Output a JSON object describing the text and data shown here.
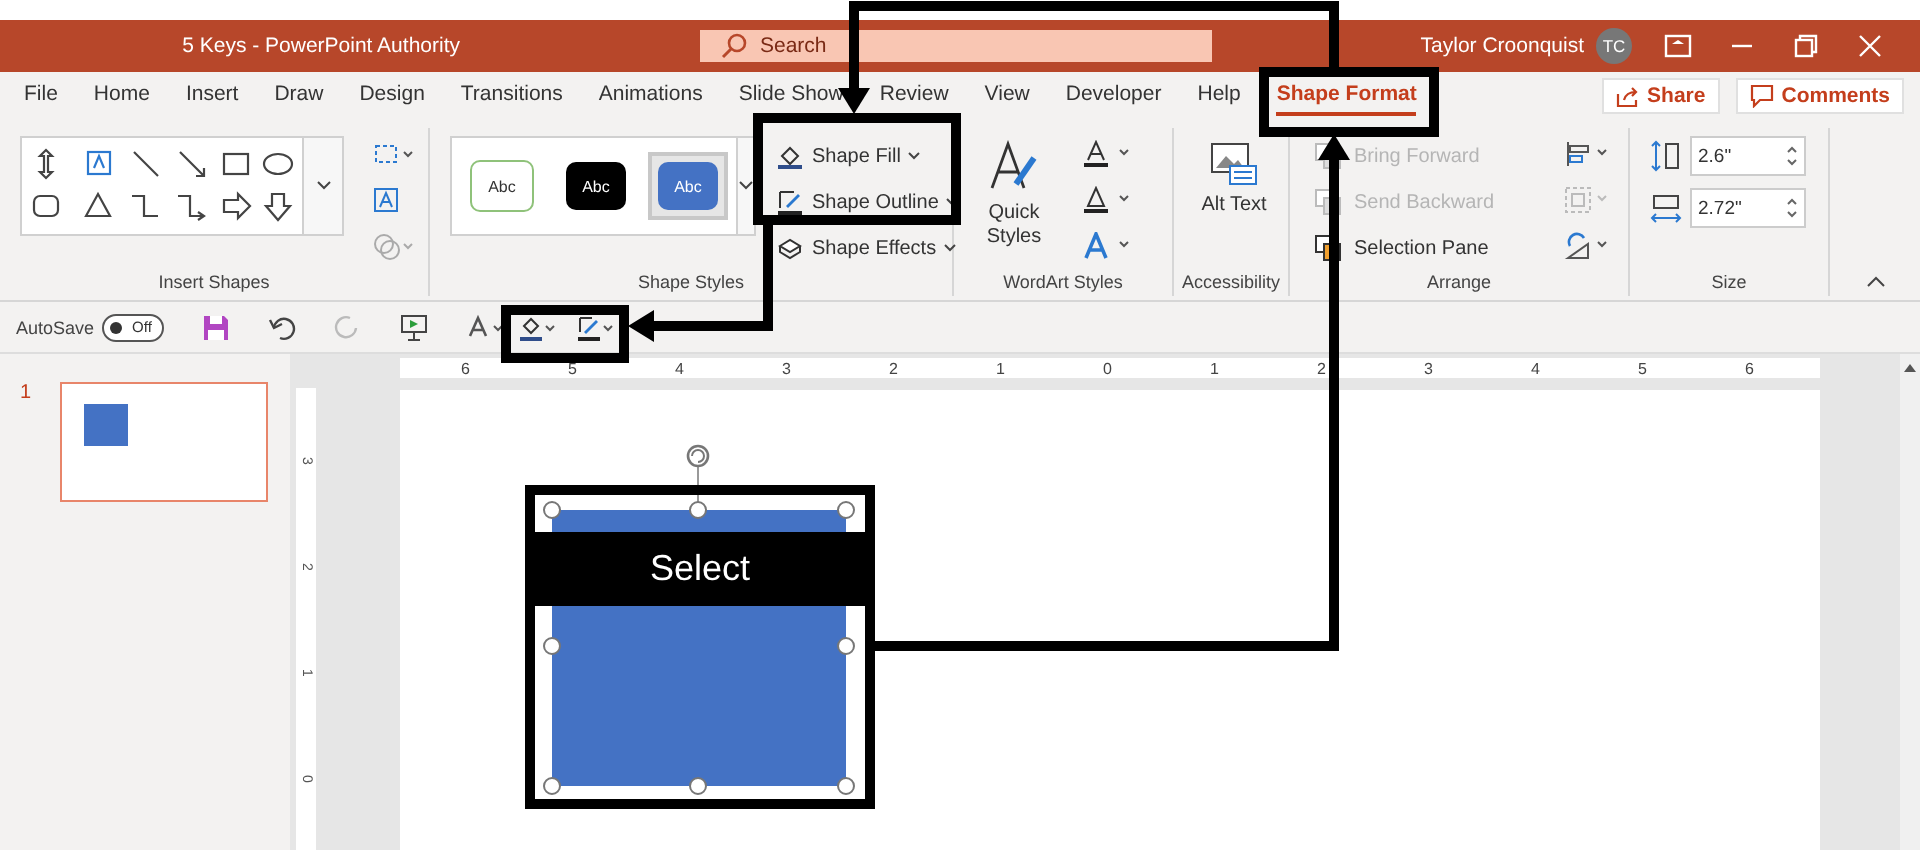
{
  "window": {
    "title": "5 Keys - PowerPoint Authority",
    "search": {
      "placeholder": "Search"
    },
    "user": "Taylor Croonquist",
    "avatar": "TC"
  },
  "tabs": [
    {
      "label": "File",
      "selected": false
    },
    {
      "label": "Home",
      "selected": false
    },
    {
      "label": "Insert",
      "selected": false
    },
    {
      "label": "Draw",
      "selected": false
    },
    {
      "label": "Design",
      "selected": false
    },
    {
      "label": "Transitions",
      "selected": false
    },
    {
      "label": "Animations",
      "selected": false
    },
    {
      "label": "Slide Show",
      "selected": false
    },
    {
      "label": "Review",
      "selected": false
    },
    {
      "label": "View",
      "selected": false
    },
    {
      "label": "Developer",
      "selected": false
    },
    {
      "label": "Help",
      "selected": false
    },
    {
      "label": "Shape Format",
      "selected": true
    }
  ],
  "actions": [
    "Share",
    "Comments"
  ],
  "ribbon": {
    "insert_shapes": {
      "label": "Insert Shapes"
    },
    "shape_styles": {
      "label": "Shape Styles",
      "swatches": [
        {
          "text": "Abc",
          "kind": "outline",
          "selected": false
        },
        {
          "text": "Abc",
          "kind": "dark",
          "selected": false
        },
        {
          "text": "Abc",
          "kind": "blue",
          "selected": true
        }
      ],
      "commands": [
        {
          "label": "Shape Fill",
          "kind": "fill"
        },
        {
          "label": "Shape Outline",
          "kind": "outline"
        },
        {
          "label": "Shape Effects",
          "kind": "effects"
        }
      ]
    },
    "wordart_styles": {
      "label": "WordArt Styles",
      "quick_styles": "Quick Styles"
    },
    "accessibility": {
      "label": "Accessibility",
      "alt_text": "Alt Text"
    },
    "arrange": {
      "label": "Arrange",
      "commands": [
        {
          "label": "Bring Forward",
          "disabled": true
        },
        {
          "label": "Send Backward",
          "disabled": true
        },
        {
          "label": "Selection Pane",
          "disabled": false
        }
      ]
    },
    "size": {
      "label": "Size",
      "height": "2.6\"",
      "width": "2.72\""
    }
  },
  "quick_access": {
    "autosave": {
      "label": "AutoSave",
      "state": "Off",
      "on": false
    }
  },
  "slides_pane": {
    "thumbnails": [
      {
        "number": "1",
        "selected": true
      }
    ]
  },
  "rulers": {
    "horizontal": [
      "6",
      "5",
      "4",
      "3",
      "2",
      "1",
      "0",
      "1",
      "2",
      "3",
      "4",
      "5",
      "6"
    ],
    "vertical": [
      "3",
      "2",
      "1",
      "0"
    ]
  },
  "callout": {
    "label": "Select"
  }
}
